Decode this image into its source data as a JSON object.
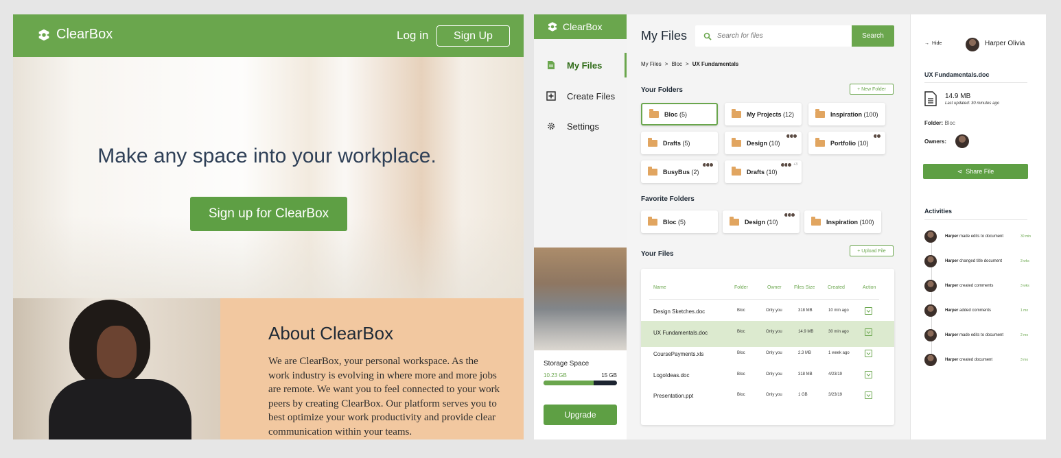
{
  "landing": {
    "brand": "ClearBox",
    "login_label": "Log in",
    "signup_label": "Sign Up",
    "headline": "Make any space into your workplace.",
    "cta_label": "Sign up for ClearBox",
    "about_title": "About ClearBox",
    "about_text": "We are ClearBox, your personal workspace. As the work industry is evolving in where more and more jobs are remote. We want you to feel connected to your work peers by creating ClearBox. Our platform serves you to best optimize your work productivity and provide clear communication within your teams."
  },
  "app": {
    "brand": "ClearBox",
    "nav": [
      {
        "label": "My Files",
        "icon": "file-icon"
      },
      {
        "label": "Create Files",
        "icon": "plus-square-icon"
      },
      {
        "label": "Settings",
        "icon": "gear-icon"
      }
    ],
    "storage": {
      "label": "Storage Space",
      "used": "10.23 GB",
      "total": "15 GB",
      "fraction": 0.682
    },
    "upgrade_label": "Upgrade",
    "page_title": "My Files",
    "search_placeholder": "Search for files",
    "search_label": "Search",
    "breadcrumb": [
      "My Files",
      "Bloc",
      "UX Fundamentals"
    ],
    "folders_title": "Your Folders",
    "new_folder_label": "+ New Folder",
    "folders": [
      {
        "name": "Bloc",
        "count": "(5)"
      },
      {
        "name": "My Projects",
        "count": "(12)"
      },
      {
        "name": "Inspiration",
        "count": "(100)"
      },
      {
        "name": "Drafts",
        "count": "(5)"
      },
      {
        "name": "Design",
        "count": "(10)"
      },
      {
        "name": "Portfolio",
        "count": "(10)"
      },
      {
        "name": "BusyBus",
        "count": "(2)"
      },
      {
        "name": "Drafts",
        "count": "(10)",
        "extra": "+3"
      }
    ],
    "favorites_title": "Favorite Folders",
    "favorites": [
      {
        "name": "Bloc",
        "count": "(5)"
      },
      {
        "name": "Design",
        "count": "(10)"
      },
      {
        "name": "Inspiration",
        "count": "(100)"
      }
    ],
    "files_title": "Your Files",
    "upload_label": "+ Upload File",
    "file_columns": [
      "Name",
      "Folder",
      "Owner",
      "Files Size",
      "Created",
      "Action"
    ],
    "files": [
      {
        "name": "Design Sketches.doc",
        "folder": "Bloc",
        "owner": "Only you",
        "size": "318 MB",
        "created": "10 min ago"
      },
      {
        "name": "UX Fundamentals.doc",
        "folder": "Bloc",
        "owner": "Only you",
        "size": "14.9 MB",
        "created": "30 min ago"
      },
      {
        "name": "CoursePayments.xls",
        "folder": "Bloc",
        "owner": "Only you",
        "size": "2.3 MB",
        "created": "1 week ago"
      },
      {
        "name": "LogoIdeas.doc",
        "folder": "Bloc",
        "owner": "Only you",
        "size": "318 MB",
        "created": "4/23/19"
      },
      {
        "name": "Presentation.ppt",
        "folder": "Bloc",
        "owner": "Only you",
        "size": "1 GB",
        "created": "3/23/19"
      }
    ],
    "detail": {
      "hide_label": "Hide",
      "user_name": "Harper Olivia",
      "doc_title": "UX Fundamentals.doc",
      "doc_size": "14.9 MB",
      "doc_updated": "Last updated: 30 minutes ago",
      "folder_key": "Folder:",
      "folder_value": "Bloc",
      "owners_key": "Owners:",
      "share_label": "Share File",
      "activities_title": "Activities",
      "activities": [
        {
          "who": "Harper",
          "what": "made edits to document",
          "when": "30 min"
        },
        {
          "who": "Harper",
          "what": "changed title document",
          "when": "3 wks"
        },
        {
          "who": "Harper",
          "what": "created comments",
          "when": "3 wks"
        },
        {
          "who": "Harper",
          "what": "added comments",
          "when": "1 mo"
        },
        {
          "who": "Harper",
          "what": "made edits to document",
          "when": "2 mo"
        },
        {
          "who": "Harper",
          "what": "created document",
          "when": "3 mo"
        }
      ]
    }
  }
}
